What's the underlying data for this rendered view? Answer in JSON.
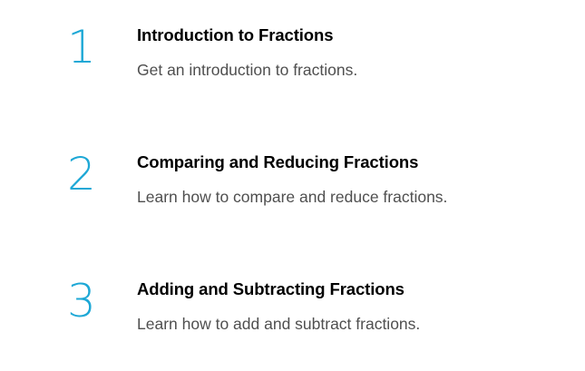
{
  "lessons": [
    {
      "number": "1",
      "title": "Introduction to Fractions",
      "description": "Get an introduction to fractions."
    },
    {
      "number": "2",
      "title": "Comparing and Reducing Fractions",
      "description": "Learn how to compare and reduce fractions."
    },
    {
      "number": "3",
      "title": "Adding and Subtracting Fractions",
      "description": "Learn how to add and subtract fractions."
    }
  ],
  "colors": {
    "accent": "#1ea8d6",
    "title": "#3f3f3f",
    "description": "#4f4f4f",
    "background": "#ffffff"
  }
}
